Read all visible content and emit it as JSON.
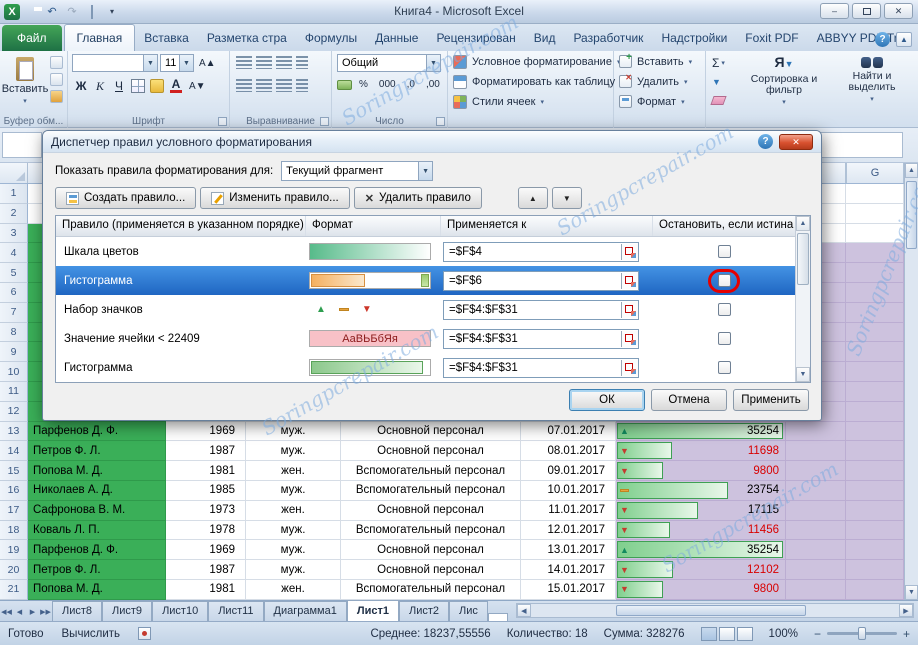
{
  "titlebar": {
    "title": "Книга4 - Microsoft Excel"
  },
  "ribbon": {
    "file_tab": "Файл",
    "active_tab": "Главная",
    "tabs": [
      "Файл",
      "Главная",
      "Вставка",
      "Разметка стра",
      "Формулы",
      "Данные",
      "Рецензирован",
      "Вид",
      "Разработчик",
      "Надстройки",
      "Foxit PDF",
      "ABBYY PDF Trar"
    ],
    "paste": "Вставить",
    "font_size": "11",
    "bold": "Ж",
    "italic": "К",
    "underline": "Ч",
    "number_format": "Общий",
    "percent": "%",
    "thousands": "000",
    "cond_format": "Условное форматирование",
    "format_as_table": "Форматировать как таблицу",
    "cell_styles": "Стили ячеек",
    "cells_insert": "Вставить",
    "cells_delete": "Удалить",
    "cells_format": "Формат",
    "sigma": "Σ",
    "sort_icon_letter": "Я",
    "sort_filter": "Сортировка и фильтр",
    "find_select": "Найти и выделить",
    "groups": {
      "clipboard": "Буфер обм...",
      "font": "Шрифт",
      "alignment": "Выравнивание",
      "number": "Число"
    }
  },
  "dialog": {
    "title": "Диспетчер правил условного форматирования",
    "show_rules_label": "Показать правила форматирования для:",
    "scope_value": "Текущий фрагмент",
    "new_rule": "Создать правило...",
    "edit_rule": "Изменить правило...",
    "delete_rule": "Удалить правило",
    "columns": [
      "Правило (применяется в указанном порядке)",
      "Формат",
      "Применяется к",
      "Остановить, если истина"
    ],
    "rules": [
      {
        "name": "Шкала цветов",
        "format": "color-scale",
        "applies_to": "=$F$4",
        "selected": false,
        "stop_checked": false,
        "annotated": false
      },
      {
        "name": "Гистограмма",
        "format": "data-bar-orange",
        "applies_to": "=$F$6",
        "selected": true,
        "stop_checked": false,
        "annotated": true
      },
      {
        "name": "Набор значков",
        "format": "icon-set",
        "applies_to": "=$F$4:$F$31",
        "selected": false,
        "stop_checked": false,
        "annotated": false
      },
      {
        "name": "Значение ячейки < 22409",
        "format": "cell-value",
        "format_sample": "АаВЬБбЯя",
        "applies_to": "=$F$4:$F$31",
        "selected": false,
        "stop_checked": false,
        "annotated": false
      },
      {
        "name": "Гистограмма",
        "format": "data-bar-green",
        "applies_to": "=$F$4:$F$31",
        "selected": false,
        "stop_checked": false,
        "annotated": false
      }
    ],
    "ok": "ОК",
    "cancel": "Отмена",
    "apply": "Применить"
  },
  "sheet": {
    "header_col": "G",
    "row_start": 1,
    "row_end": 21,
    "rows": [
      {
        "n": 13,
        "name": "Парфенов Д. Ф.",
        "year": "1969",
        "gender": "муж.",
        "category": "Основной персонал",
        "date": "07.01.2017",
        "icon": "up",
        "value": "35254",
        "red": false,
        "bar": 100
      },
      {
        "n": 14,
        "name": "Петров Ф. Л.",
        "year": "1987",
        "gender": "муж.",
        "category": "Основной персонал",
        "date": "08.01.2017",
        "icon": "down",
        "value": "11698",
        "red": true,
        "bar": 33
      },
      {
        "n": 15,
        "name": "Попова М. Д.",
        "year": "1981",
        "gender": "жен.",
        "category": "Вспомогательный персонал",
        "date": "09.01.2017",
        "icon": "down",
        "value": "9800",
        "red": true,
        "bar": 28
      },
      {
        "n": 16,
        "name": "Николаев А. Д.",
        "year": "1985",
        "gender": "муж.",
        "category": "Вспомогательный персонал",
        "date": "10.01.2017",
        "icon": "dash",
        "value": "23754",
        "red": false,
        "bar": 67
      },
      {
        "n": 17,
        "name": "Сафронова В. М.",
        "year": "1973",
        "gender": "жен.",
        "category": "Основной персонал",
        "date": "11.01.2017",
        "icon": "down",
        "value": "17115",
        "red": false,
        "bar": 49
      },
      {
        "n": 18,
        "name": "Коваль Л. П.",
        "year": "1978",
        "gender": "муж.",
        "category": "Вспомогательный персонал",
        "date": "12.01.2017",
        "icon": "down",
        "value": "11456",
        "red": true,
        "bar": 32
      },
      {
        "n": 19,
        "name": "Парфенов Д. Ф.",
        "year": "1969",
        "gender": "муж.",
        "category": "Основной персонал",
        "date": "13.01.2017",
        "icon": "up",
        "value": "35254",
        "red": false,
        "bar": 100
      },
      {
        "n": 20,
        "name": "Петров Ф. Л.",
        "year": "1987",
        "gender": "муж.",
        "category": "Основной персонал",
        "date": "14.01.2017",
        "icon": "down",
        "value": "12102",
        "red": true,
        "bar": 34
      },
      {
        "n": 21,
        "name": "Попова М. Д.",
        "year": "1981",
        "gender": "жен.",
        "category": "Вспомогательный персонал",
        "date": "15.01.2017",
        "icon": "down",
        "value": "9800",
        "red": true,
        "bar": 28
      }
    ]
  },
  "tabs_bar": {
    "active": "Лист1",
    "sheets": [
      "Лист8",
      "Лист9",
      "Лист10",
      "Лист11",
      "Диаграмма1",
      "Лист1",
      "Лист2",
      "Лис"
    ]
  },
  "status_bar": {
    "ready": "Готово",
    "calc": "Вычислить",
    "average": "Среднее: 18237,55556",
    "count": "Количество: 18",
    "sum": "Сумма: 328276",
    "zoom": "100%"
  },
  "watermark": "Soringpcrepair.com"
}
